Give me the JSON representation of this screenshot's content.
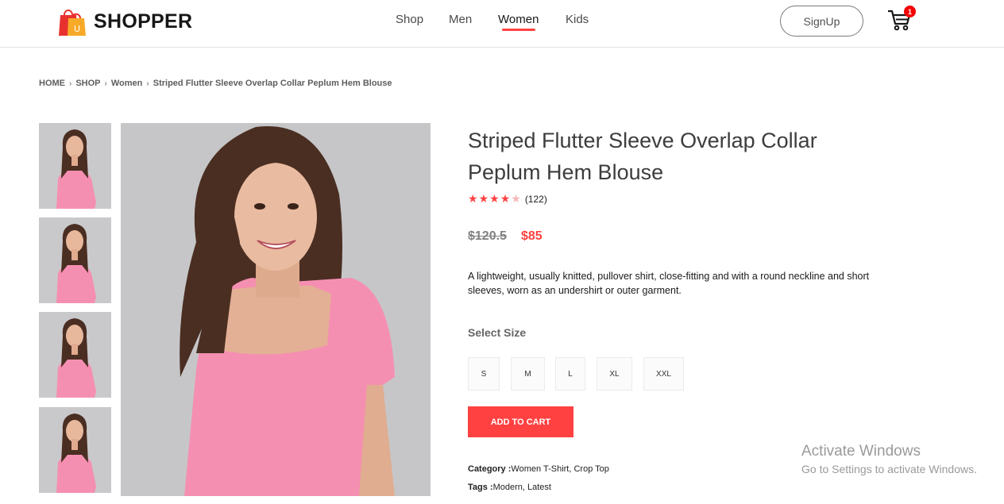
{
  "brand": {
    "name": "SHOPPER",
    "logo_letter": "U"
  },
  "nav": {
    "items": [
      "Shop",
      "Men",
      "Women",
      "Kids"
    ],
    "active": "Women",
    "signup_label": "SignUp",
    "cart_count": "1"
  },
  "breadcrumb": [
    "HOME",
    "SHOP",
    "Women",
    "Striped Flutter Sleeve Overlap Collar Peplum Hem Blouse"
  ],
  "product": {
    "title": "Striped Flutter Sleeve Overlap Collar Peplum Hem Blouse",
    "rating": 4,
    "rating_max": 5,
    "review_count": "(122)",
    "old_price": "$120.5",
    "new_price": "$85",
    "description": "A lightweight, usually knitted, pullover shirt, close-fitting and with a round neckline and short sleeves, worn as an undershirt or outer garment.",
    "size_label": "Select Size",
    "sizes": [
      "S",
      "M",
      "L",
      "XL",
      "XXL"
    ],
    "add_to_cart_label": "ADD TO CART",
    "category_label": "Category :",
    "category_value": "Women T-Shirt, Crop Top",
    "tags_label": "Tags :",
    "tags_value": "Modern, Latest",
    "thumbnail_count": 4,
    "colors": {
      "accent": "#ff4141",
      "shirt": "#f58fb1",
      "background": "#c6c6c8",
      "hair": "#4a2e22"
    }
  },
  "watermark": {
    "title": "Activate Windows",
    "subtitle": "Go to Settings to activate Windows."
  }
}
